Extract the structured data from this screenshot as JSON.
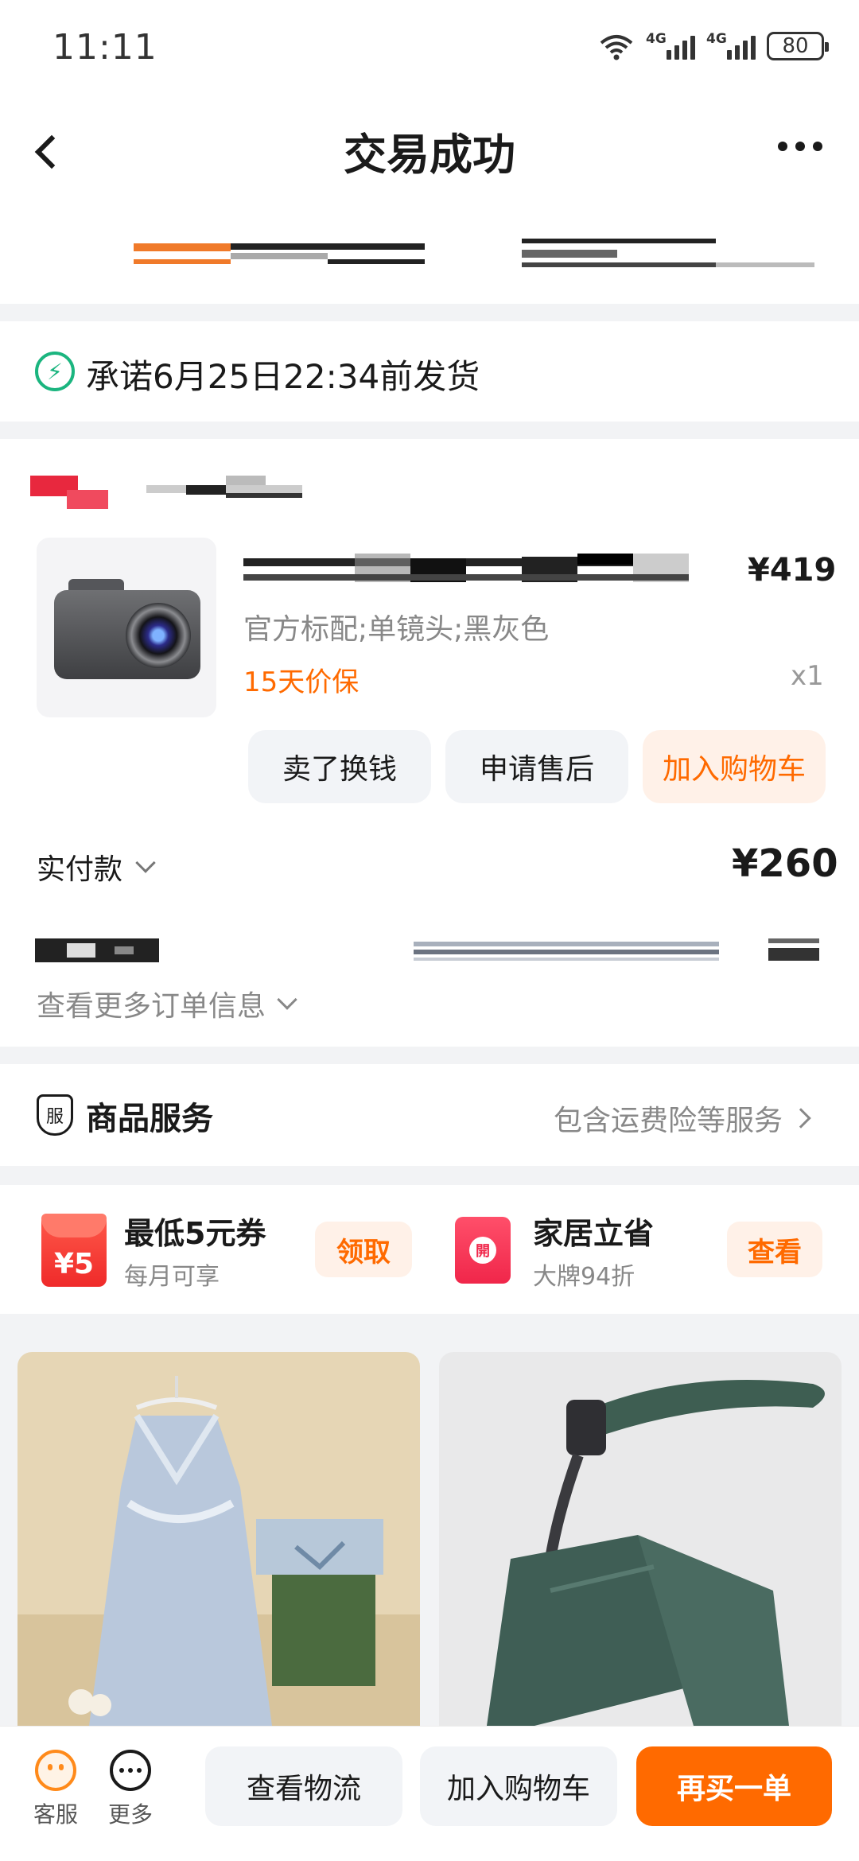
{
  "status_bar": {
    "time": "11:11",
    "signal_1_label": "4G",
    "signal_2_label": "4G",
    "battery": "80"
  },
  "header": {
    "title": "交易成功"
  },
  "shipping": {
    "promise": "承诺6月25日22:34前发货"
  },
  "order": {
    "product": {
      "price": "¥419",
      "spec": "官方标配;单镜头;黑灰色",
      "protection": "15天价保",
      "quantity": "x1",
      "image_icon": "camera"
    },
    "actions": {
      "sell_label": "卖了换钱",
      "after_sale_label": "申请售后",
      "add_cart_label": "加入购物车"
    },
    "paid_label": "实付款",
    "paid_amount": "¥260",
    "more_info_label": "查看更多订单信息"
  },
  "service": {
    "title": "商品服务",
    "icon_text": "服",
    "link": "包含运费险等服务"
  },
  "promos": [
    {
      "title": "最低5元券",
      "subtitle": "每月可享",
      "button": "领取",
      "icon_text": "¥5"
    },
    {
      "title": "家居立省",
      "subtitle": "大牌94折",
      "button": "查看",
      "icon_text": "開"
    }
  ],
  "bottom_bar": {
    "service_label": "客服",
    "more_label": "更多",
    "logistics_label": "查看物流",
    "add_cart_label": "加入购物车",
    "rebuy_label": "再买一单"
  },
  "colors": {
    "accent": "#ff6a00",
    "green": "#1bb57f",
    "background": "#f2f3f5"
  }
}
